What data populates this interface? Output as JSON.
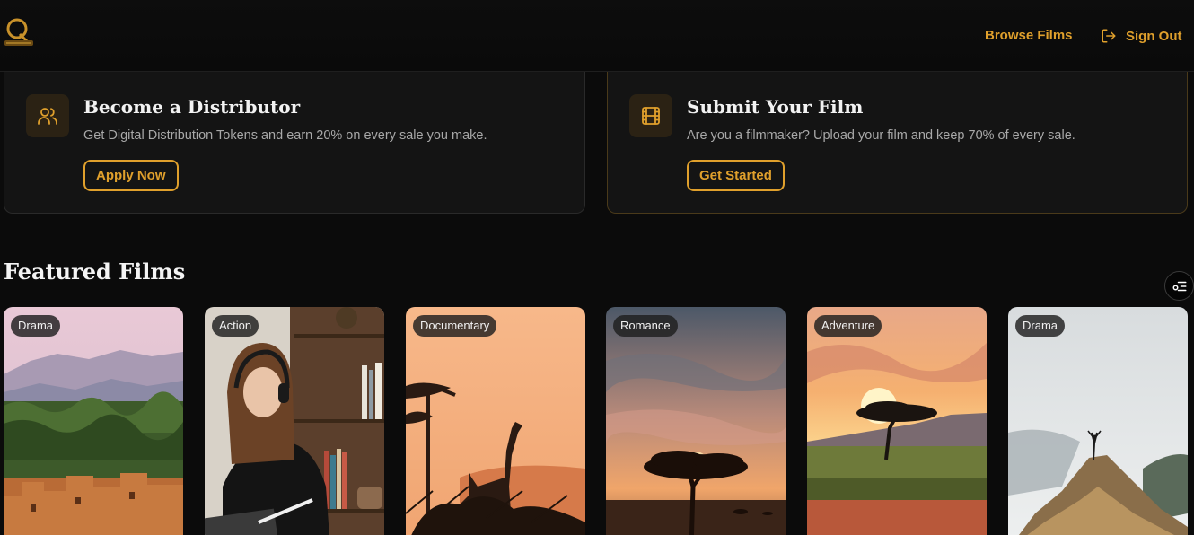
{
  "nav": {
    "browse": "Browse Films",
    "signout": "Sign Out"
  },
  "cards": [
    {
      "title": "Become a Distributor",
      "description": "Get Digital Distribution Tokens and earn 20% on every sale you make.",
      "button": "Apply Now",
      "icon": "users-icon"
    },
    {
      "title": "Submit Your Film",
      "description": "Are you a filmmaker? Upload your film and keep 70% of every sale.",
      "button": "Get Started",
      "icon": "film-icon"
    }
  ],
  "featured": {
    "title": "Featured Films",
    "films": [
      {
        "genre": "Drama"
      },
      {
        "genre": "Action"
      },
      {
        "genre": "Documentary"
      },
      {
        "genre": "Romance"
      },
      {
        "genre": "Adventure"
      },
      {
        "genre": "Drama"
      }
    ]
  },
  "colors": {
    "accent": "#e0a02c",
    "background": "#0b0b0b",
    "card": "#141414"
  }
}
